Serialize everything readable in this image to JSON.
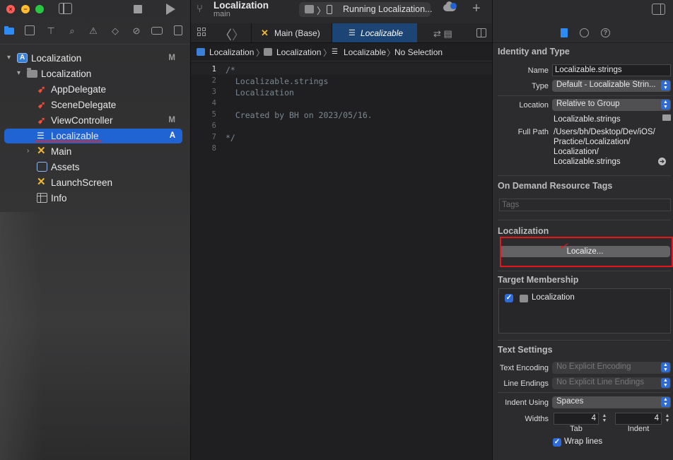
{
  "window": {
    "project_title": "Localization",
    "branch": "main",
    "status": "Running Localization..."
  },
  "navigator": {
    "items": [
      {
        "label": "Localization",
        "badge": "M",
        "icon": "xcodeproj-icon"
      },
      {
        "label": "Localization",
        "badge": "",
        "icon": "folder-icon"
      },
      {
        "label": "AppDelegate",
        "badge": "",
        "icon": "swift-file-icon"
      },
      {
        "label": "SceneDelegate",
        "badge": "",
        "icon": "swift-file-icon"
      },
      {
        "label": "ViewController",
        "badge": "M",
        "icon": "swift-file-icon"
      },
      {
        "label": "Localizable",
        "badge": "A",
        "icon": "strings-file-icon"
      },
      {
        "label": "Main",
        "badge": "",
        "icon": "storyboard-icon"
      },
      {
        "label": "Assets",
        "badge": "",
        "icon": "asset-catalog-icon"
      },
      {
        "label": "LaunchScreen",
        "badge": "",
        "icon": "storyboard-icon"
      },
      {
        "label": "Info",
        "badge": "",
        "icon": "plist-icon"
      }
    ]
  },
  "editor": {
    "tabs": [
      {
        "label": "Main (Base)"
      },
      {
        "label": "Localizable"
      }
    ],
    "breadcrumb": [
      "Localization",
      "Localization",
      "Localizable",
      "No Selection"
    ],
    "line_numbers": [
      "1",
      "2",
      "3",
      "4",
      "5",
      "6",
      "7",
      "8"
    ],
    "lines": [
      "/*",
      "  Localizable.strings",
      "  Localization",
      "",
      "  Created by BH on 2023/05/16.",
      "",
      "*/",
      ""
    ]
  },
  "inspector": {
    "identity": {
      "title": "Identity and Type",
      "name_label": "Name",
      "name_value": "Localizable.strings",
      "type_label": "Type",
      "type_value": "Default - Localizable Strin...",
      "location_label": "Location",
      "location_value": "Relative to Group",
      "location_file": "Localizable.strings",
      "full_path_label": "Full Path",
      "full_path_lines": [
        "/Users/bh/Desktop/Dev/iOS/",
        "Practice/Localization/",
        "Localization/",
        "Localizable.strings"
      ]
    },
    "on_demand": {
      "title": "On Demand Resource Tags",
      "tags_placeholder": "Tags"
    },
    "localization": {
      "title": "Localization",
      "button_label": "Localize..."
    },
    "membership": {
      "title": "Target Membership",
      "target": "Localization",
      "checked": true
    },
    "text_settings": {
      "title": "Text Settings",
      "encoding_label": "Text Encoding",
      "encoding_value": "No Explicit Encoding",
      "line_endings_label": "Line Endings",
      "line_endings_value": "No Explicit Line Endings",
      "indent_label": "Indent Using",
      "indent_value": "Spaces",
      "widths_label": "Widths",
      "tab_value": "4",
      "indent_width_value": "4",
      "tab_sub_label": "Tab",
      "indent_sub_label": "Indent",
      "wrap_label": "Wrap lines",
      "wrap_checked": true
    }
  },
  "colors": {
    "accent": "#2064d3",
    "annotation": "#e3171b"
  }
}
